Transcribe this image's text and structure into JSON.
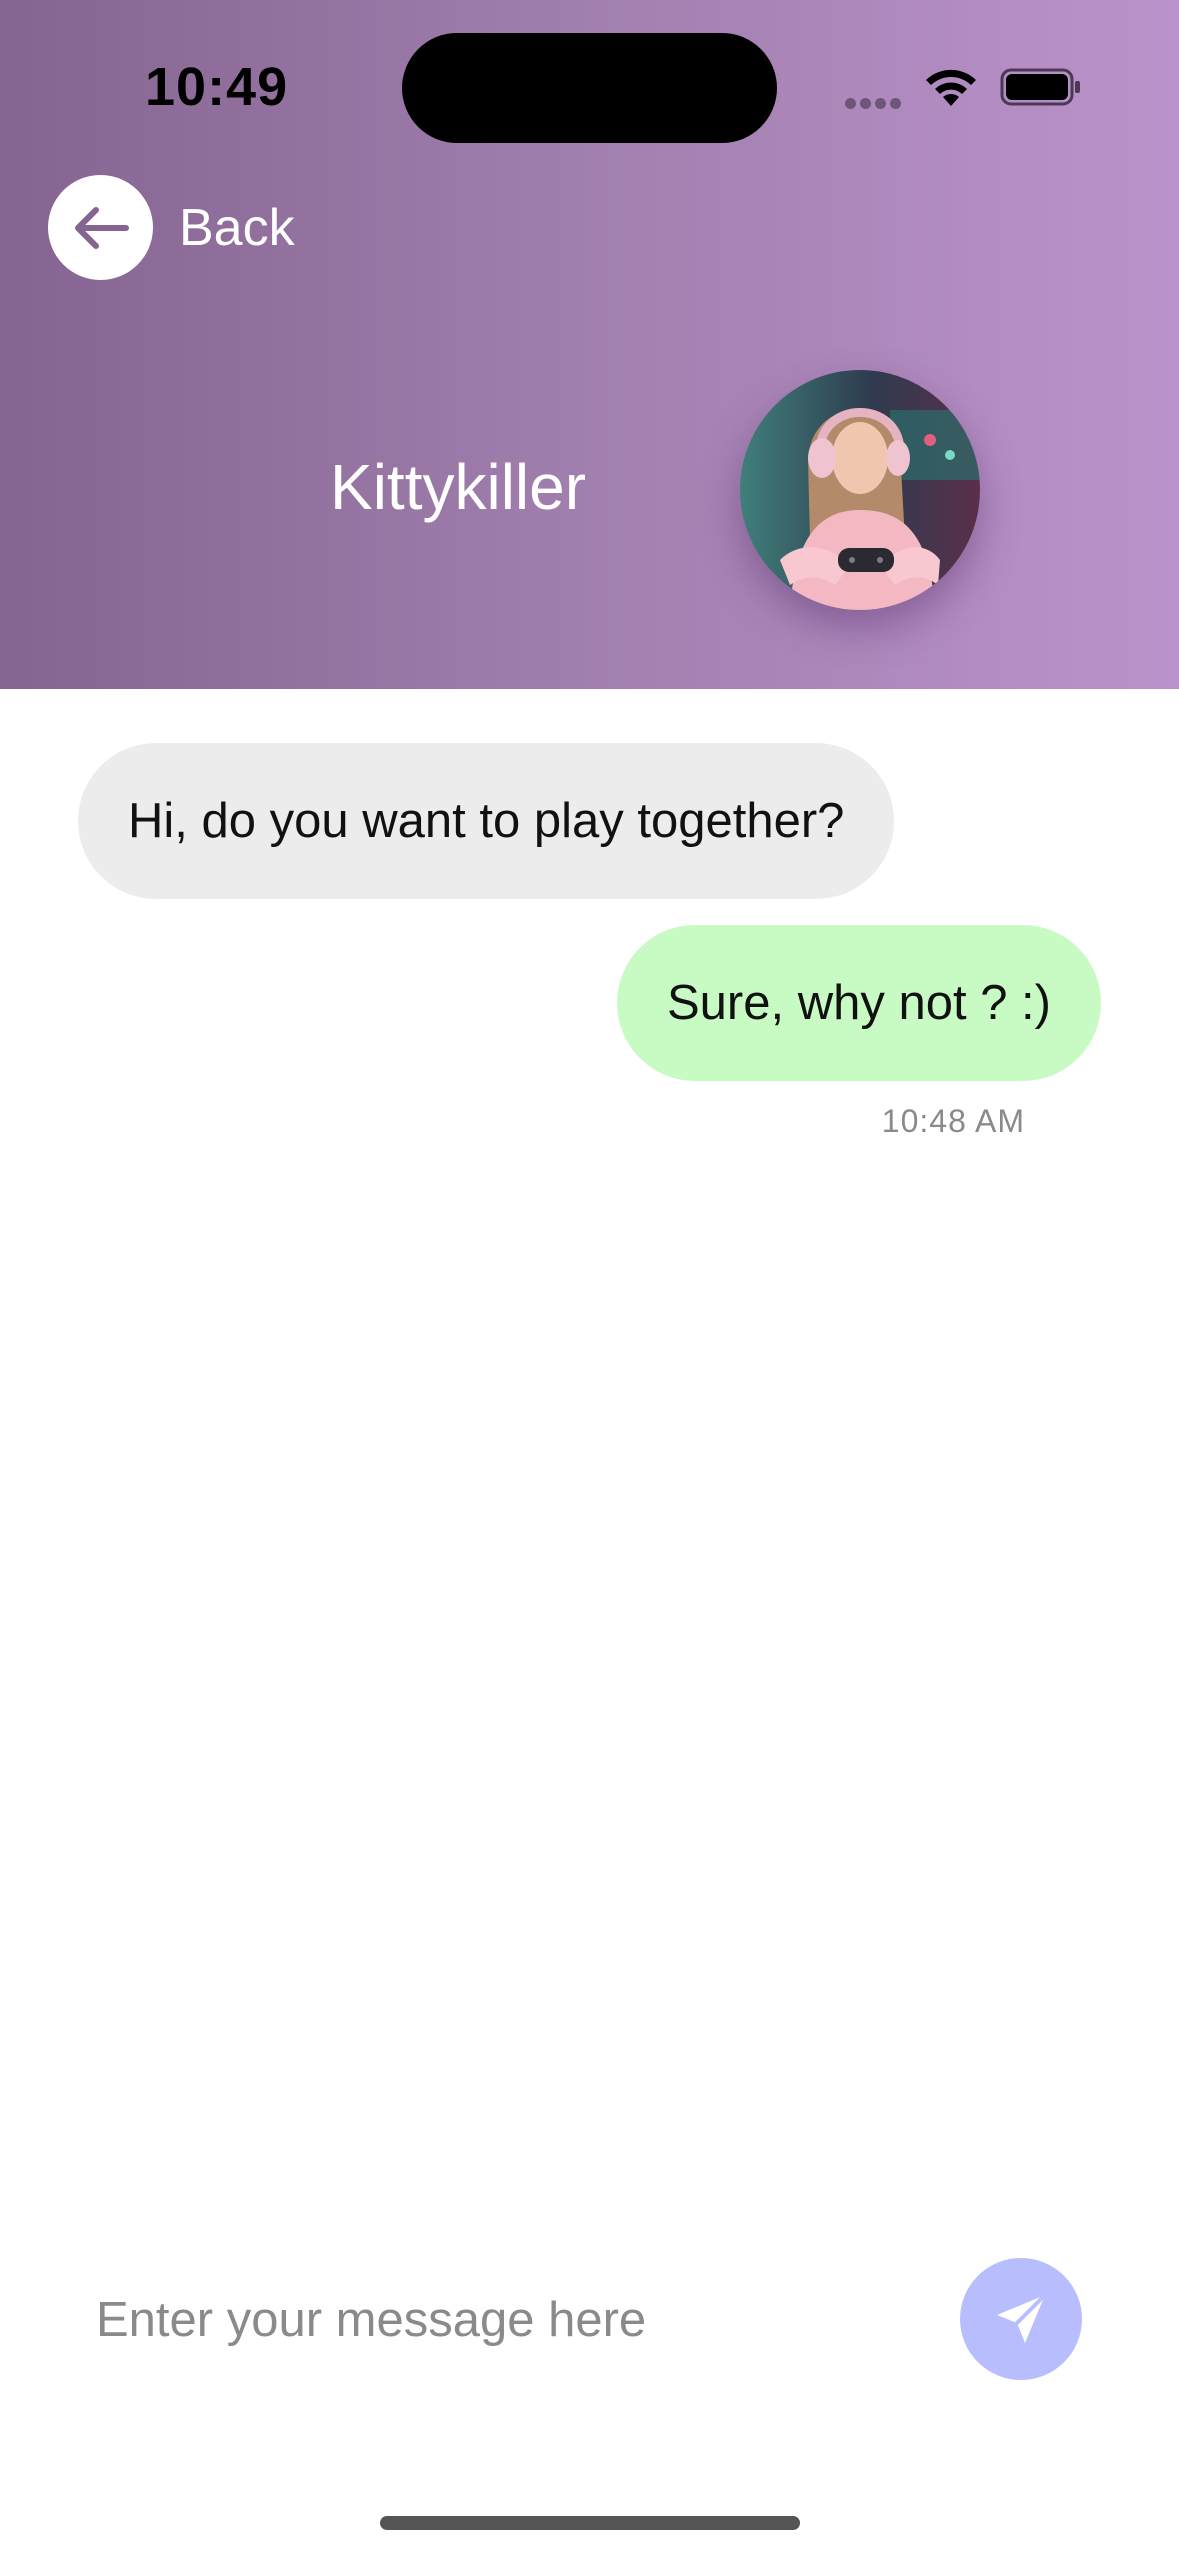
{
  "status_bar": {
    "time": "10:49",
    "icons": [
      "cellular-signal-icon",
      "wifi-icon",
      "battery-icon"
    ]
  },
  "header": {
    "back_label": "Back",
    "back_icon": "arrow-left-icon",
    "contact_name": "Kittykiller",
    "avatar": "gamer-girl-avatar",
    "gradient_colors": [
      "#866491",
      "#bb93cc"
    ]
  },
  "messages": [
    {
      "direction": "incoming",
      "text": "Hi, do you want to play together?",
      "bubble_color": "#ececec"
    },
    {
      "direction": "outgoing",
      "text": "Sure, why not ? :)",
      "bubble_color": "#c8fbc3",
      "time": "10:48 AM"
    }
  ],
  "composer": {
    "placeholder": "Enter your message here",
    "value": "",
    "send_icon": "paper-plane-icon",
    "send_button_color": "#b8bdfd"
  }
}
